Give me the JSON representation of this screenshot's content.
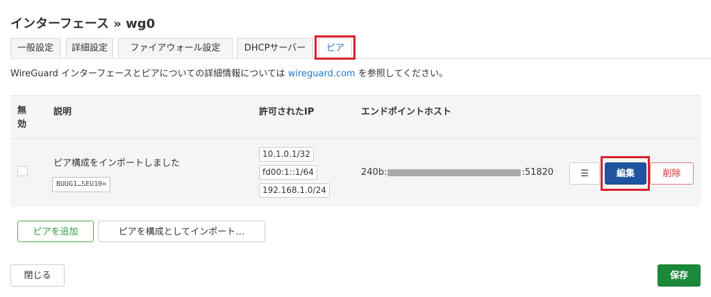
{
  "page": {
    "title": "インターフェース » wg0"
  },
  "tabs": [
    {
      "label": "一般設定"
    },
    {
      "label": "詳細設定"
    },
    {
      "label": "ファイアウォール設定"
    },
    {
      "label": "DHCPサーバー"
    },
    {
      "label": "ピア",
      "active": true
    }
  ],
  "description": {
    "before": "WireGuard インターフェースとピアについての詳細情報については ",
    "link": "wireguard.com",
    "after": " を参照してください。"
  },
  "table": {
    "headers": {
      "disabled_line1": "無",
      "disabled_line2": "効",
      "description": "説明",
      "allowed_ips": "許可されたIP",
      "endpoint_host": "エンドポイントホスト"
    },
    "rows": [
      {
        "description": "ピア構成をインポートしました",
        "key": "BUUG1…SEU10=",
        "allowed_ips": [
          "10.1.0.1/32",
          "fd00:1::1/64",
          "192.168.1.0/24"
        ],
        "endpoint_prefix": "240b:",
        "endpoint_port": ":51820",
        "menu_label": "☰",
        "edit_label": "編集",
        "delete_label": "削除"
      }
    ]
  },
  "actions": {
    "add_peer": "ピアを追加",
    "import_peer": "ピアを構成としてインポート…",
    "close": "閉じる",
    "save": "保存"
  },
  "colors": {
    "highlight": "#d9202a",
    "link": "#1f78c8",
    "edit_button": "#1e54a0",
    "save_button": "#1a8a3a",
    "add_button": "#2a9d3a",
    "delete_button": "#c9302c"
  }
}
